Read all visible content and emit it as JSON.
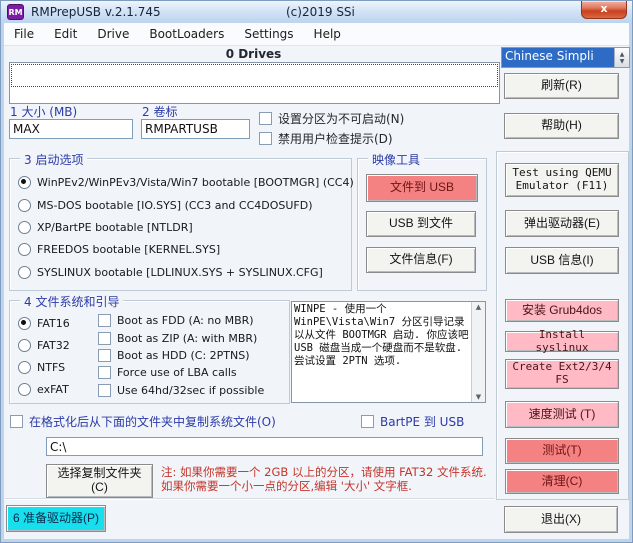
{
  "window": {
    "title": "RMPrepUSB v.2.1.745",
    "copyright": "(c)2019 SSi",
    "icon": "RM"
  },
  "icons": {
    "close": "x",
    "up_arrow": "▲",
    "down_arrow": "▼"
  },
  "menu": {
    "items": [
      "File",
      "Edit",
      "Drive",
      "BootLoaders",
      "Settings",
      "Help"
    ]
  },
  "drives": {
    "count": "0 Drives"
  },
  "language": {
    "selected": "Chinese Simpli"
  },
  "size_field": {
    "label": "1 大小 (MB)",
    "value": "MAX"
  },
  "volume_field": {
    "label": "2 卷标",
    "value": "RMPARTUSB"
  },
  "partition_checks": {
    "non_bootable": "设置分区为不可启动(N)",
    "no_prompts": "禁用用户检查提示(D)"
  },
  "boot_options": {
    "title": "3 启动选项",
    "options": [
      "WinPEv2/WinPEv3/Vista/Win7 bootable [BOOTMGR] (CC4)",
      "MS-DOS bootable [IO.SYS]   (CC3 and CC4DOSUFD)",
      "XP/BartPE bootable [NTLDR]",
      "FREEDOS bootable [KERNEL.SYS]",
      "SYSLINUX bootable [LDLINUX.SYS + SYSLINUX.CFG]"
    ],
    "selected_index": 0
  },
  "image_tools": {
    "title": "映像工具",
    "file_to_usb": "文件到 USB",
    "usb_to_file": "USB 到文件",
    "file_info": "文件信息(F)"
  },
  "filesystem": {
    "title": "4 文件系统和引导",
    "options": [
      "FAT16",
      "FAT32",
      "NTFS",
      "exFAT"
    ],
    "selected_index": 0,
    "checks": [
      "Boot as FDD (A: no MBR)",
      "Boot as ZIP (A: with MBR)",
      "Boot as HDD (C: 2PTNS)",
      "Force use of LBA calls",
      "Use 64hd/32sec if possible"
    ]
  },
  "info_box": {
    "text": "WINPE - 使用一个 WinPE\\Vista\\Win7 分区引导记录以从文件 BOOTMGR 启动. 你应该吧 USB 磁盘当成一个硬盘而不是软盘. 尝试设置 2PTN 选项."
  },
  "copy_section": {
    "copy_check": "在格式化后从下面的文件夹中复制系统文件(O)",
    "bartpe_check": "BartPE 到 USB",
    "path_value": "C:\\",
    "choose_button": "选择复制文件夹(C)",
    "note": "注: 如果你需要一个 2GB 以上的分区，请使用 FAT32 文件系统. 如果你需要一个小一点的分区,编辑 '大小' 文字框."
  },
  "actions": {
    "refresh": "刷新(R)",
    "help": "帮助(H)",
    "qemu": "Test using QEMU Emulator (F11)",
    "eject": "弹出驱动器(E)",
    "usb_info": "USB 信息(I)",
    "grub4dos": "安装 Grub4dos",
    "syslinux": "Install syslinux",
    "ext_fs": "Create Ext2/3/4 FS",
    "speed_test": "速度测试 (T)",
    "test": "测试(T)",
    "clean": "清理(C)",
    "exit": "退出(X)",
    "prepare": "6 准备驱动器(P)"
  }
}
